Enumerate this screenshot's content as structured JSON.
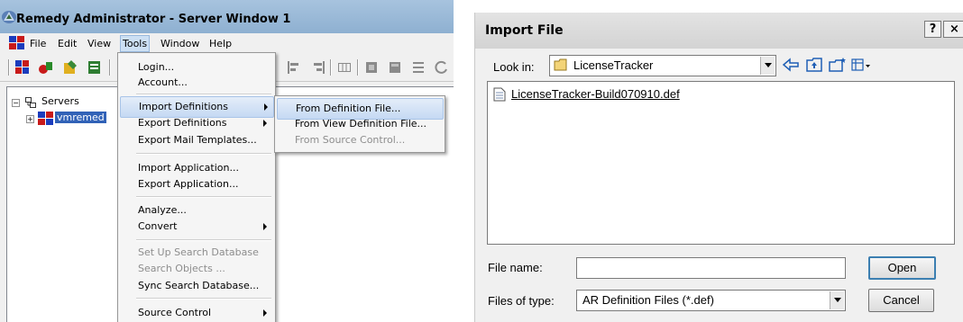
{
  "remedy": {
    "title": "Remedy Administrator - Server Window 1",
    "menubar": [
      "File",
      "Edit",
      "View",
      "Tools",
      "Window",
      "Help"
    ],
    "tree": {
      "root_label": "Servers",
      "server_label": "vmremed"
    },
    "tools_menu": {
      "items": [
        {
          "label": "Login...",
          "disabled": false
        },
        {
          "label": "Account...",
          "disabled": false
        },
        {
          "label": "Import Definitions",
          "submenu": true
        },
        {
          "label": "Export Definitions",
          "submenu": true
        },
        {
          "label": "Export Mail Templates...",
          "disabled": false
        },
        {
          "label": "Import Application...",
          "disabled": false
        },
        {
          "label": "Export Application...",
          "disabled": false
        },
        {
          "label": "Analyze...",
          "disabled": false
        },
        {
          "label": "Convert",
          "submenu": true
        },
        {
          "label": "Set Up Search Database",
          "disabled": true
        },
        {
          "label": "Search Objects ...",
          "disabled": true
        },
        {
          "label": "Sync Search Database...",
          "disabled": false
        },
        {
          "label": "Source Control",
          "submenu": true
        }
      ]
    },
    "import_submenu": {
      "items": [
        {
          "label": "From Definition File...",
          "disabled": false
        },
        {
          "label": "From View Definition File...",
          "disabled": false
        },
        {
          "label": "From Source Control...",
          "disabled": true
        }
      ]
    }
  },
  "dialog": {
    "title": "Import File",
    "help_button": "?",
    "close_button": "×",
    "look_in_label": "Look in:",
    "look_in_value": "LicenseTracker",
    "file_item": "LicenseTracker-Build070910.def",
    "file_name_label": "File name:",
    "file_name_value": "",
    "files_of_type_label": "Files of type:",
    "files_of_type_value": "AR Definition Files (*.def)",
    "open_button": "Open",
    "cancel_button": "Cancel"
  }
}
